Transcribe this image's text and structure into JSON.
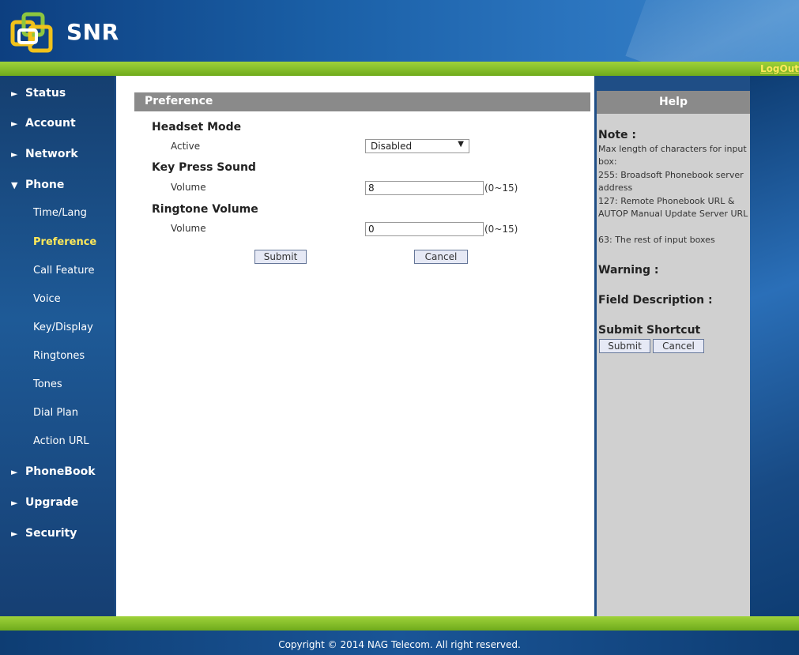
{
  "header": {
    "brand": "SNR",
    "logout": "LogOut"
  },
  "nav": {
    "status": "Status",
    "account": "Account",
    "network": "Network",
    "phone": "Phone",
    "phone_sub": {
      "time_lang": "Time/Lang",
      "preference": "Preference",
      "call_feature": "Call Feature",
      "voice": "Voice",
      "key_display": "Key/Display",
      "ringtones": "Ringtones",
      "tones": "Tones",
      "dial_plan": "Dial Plan",
      "action_url": "Action URL"
    },
    "phonebook": "PhoneBook",
    "upgrade": "Upgrade",
    "security": "Security"
  },
  "main": {
    "title": "Preference",
    "headset": {
      "section": "Headset Mode",
      "label": "Active",
      "value": "Disabled"
    },
    "key_press": {
      "section": "Key Press Sound",
      "label": "Volume",
      "value": "8",
      "range": "(0~15)"
    },
    "ringtone": {
      "section": "Ringtone Volume",
      "label": "Volume",
      "value": "0",
      "range": "(0~15)"
    },
    "submit": "Submit",
    "cancel": "Cancel"
  },
  "help": {
    "title": "Help",
    "note_title": "Note :",
    "note_lines": [
      "Max length of characters for input box:",
      "255: Broadsoft Phonebook server address",
      "127: Remote Phonebook URL & AUTOP Manual Update Server URL",
      "63: The rest of input boxes"
    ],
    "warning_title": "Warning :",
    "field_desc_title": "Field Description :",
    "shortcut_title": "Submit Shortcut",
    "submit": "Submit",
    "cancel": "Cancel"
  },
  "footer": {
    "copyright": "Copyright © 2014 NAG Telecom. All right reserved."
  },
  "colors": {
    "green_bar": "#8cc52d",
    "nav_bg": "#1e5a97",
    "active_nav": "#ffe95a",
    "panel_header": "#8a8a8a",
    "help_bg": "#d0d0d0"
  }
}
